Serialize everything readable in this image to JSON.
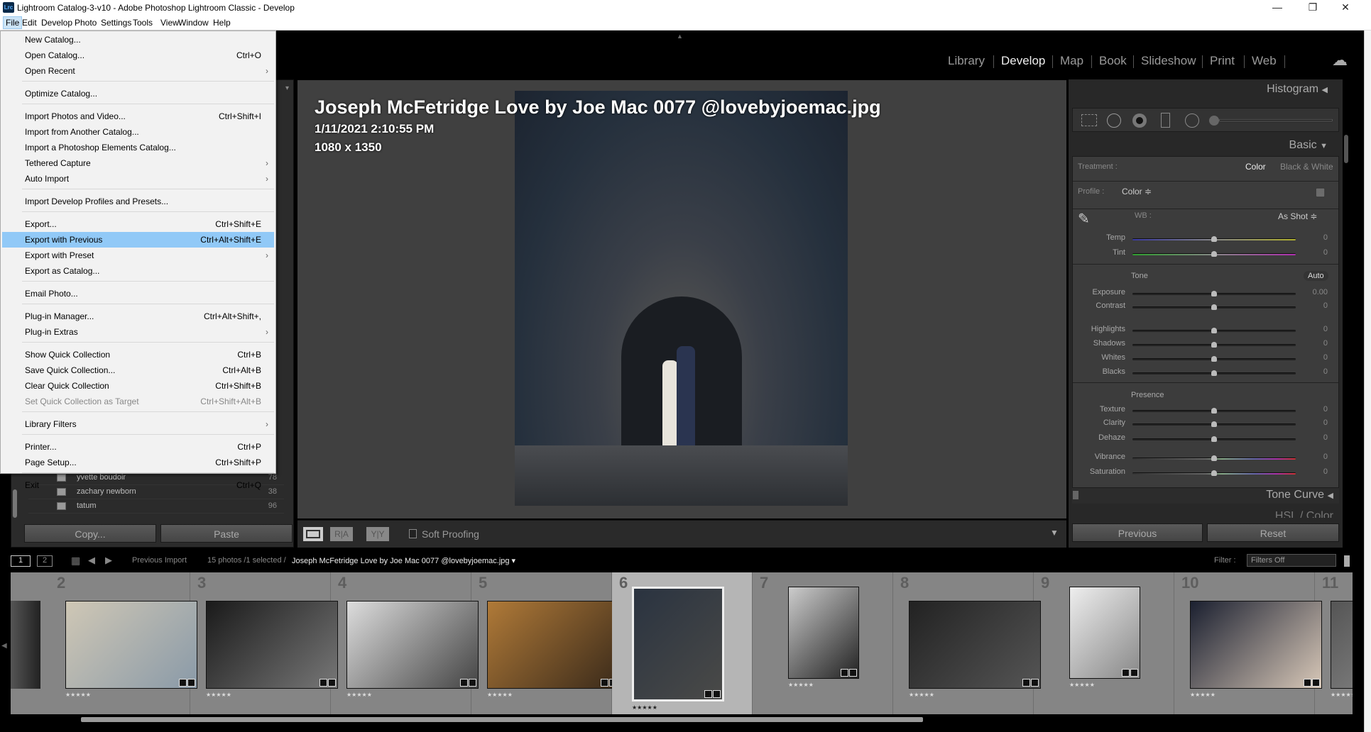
{
  "window": {
    "title": "Lightroom Catalog-3-v10 - Adobe Photoshop Lightroom Classic - Develop",
    "logo": "Lrc",
    "minimize": "—",
    "maximize": "❐",
    "close": "✕"
  },
  "menubar": [
    "File",
    "Edit",
    "Develop",
    "Photo",
    "Settings",
    "Tools",
    "View",
    "Window",
    "Help"
  ],
  "file_menu": [
    {
      "label": "New Catalog..."
    },
    {
      "label": "Open Catalog...",
      "shortcut": "Ctrl+O"
    },
    {
      "label": "Open Recent",
      "submenu": true
    },
    {
      "sep": true
    },
    {
      "label": "Optimize Catalog..."
    },
    {
      "sep": true
    },
    {
      "label": "Import Photos and Video...",
      "shortcut": "Ctrl+Shift+I"
    },
    {
      "label": "Import from Another Catalog..."
    },
    {
      "label": "Import a Photoshop Elements Catalog..."
    },
    {
      "label": "Tethered Capture",
      "submenu": true
    },
    {
      "label": "Auto Import",
      "submenu": true
    },
    {
      "sep": true
    },
    {
      "label": "Import Develop Profiles and Presets..."
    },
    {
      "sep": true
    },
    {
      "label": "Export...",
      "shortcut": "Ctrl+Shift+E"
    },
    {
      "label": "Export with Previous",
      "shortcut": "Ctrl+Alt+Shift+E",
      "highlighted": true
    },
    {
      "label": "Export with Preset",
      "submenu": true
    },
    {
      "label": "Export as Catalog..."
    },
    {
      "sep": true
    },
    {
      "label": "Email Photo..."
    },
    {
      "sep": true
    },
    {
      "label": "Plug-in Manager...",
      "shortcut": "Ctrl+Alt+Shift+,"
    },
    {
      "label": "Plug-in Extras",
      "submenu": true
    },
    {
      "sep": true
    },
    {
      "label": "Show Quick Collection",
      "shortcut": "Ctrl+B"
    },
    {
      "label": "Save Quick Collection...",
      "shortcut": "Ctrl+Alt+B"
    },
    {
      "label": "Clear Quick Collection",
      "shortcut": "Ctrl+Shift+B"
    },
    {
      "label": "Set Quick Collection as Target",
      "shortcut": "Ctrl+Shift+Alt+B",
      "disabled": true
    },
    {
      "sep": true
    },
    {
      "label": "Library Filters",
      "submenu": true
    },
    {
      "sep": true
    },
    {
      "label": "Printer...",
      "shortcut": "Ctrl+P"
    },
    {
      "label": "Page Setup...",
      "shortcut": "Ctrl+Shift+P"
    },
    {
      "sep": true
    },
    {
      "label": "Exit",
      "shortcut": "Ctrl+Q"
    }
  ],
  "modules": {
    "items": [
      "Library",
      "Develop",
      "Map",
      "Book",
      "Slideshow",
      "Print",
      "Web"
    ],
    "active": "Develop",
    "cloud_icon": "cloud-icon"
  },
  "left_panel": {
    "folders": [
      {
        "name": "yvette boudoir",
        "count": "78"
      },
      {
        "name": "zachary newborn",
        "count": "38"
      },
      {
        "name": "tatum",
        "count": "96"
      }
    ],
    "copy": "Copy...",
    "paste": "Paste"
  },
  "photo_info": {
    "filename": "Joseph McFetridge Love by Joe Mac 0077 @lovebyjoemac.jpg",
    "date": "1/11/2021 2:10:55 PM",
    "dimensions": "1080 x 1350"
  },
  "toolbar": {
    "soft_proofing": "Soft Proofing",
    "ra": "R|A",
    "yy": "Y|Y"
  },
  "right_panel": {
    "histogram": "Histogram",
    "basic": "Basic",
    "treatment_label": "Treatment :",
    "treatment_color": "Color",
    "treatment_bw": "Black & White",
    "profile_label": "Profile :",
    "profile_value": "Color ≑",
    "wb_label": "WB :",
    "wb_value": "As Shot ≑",
    "tone": "Tone",
    "auto": "Auto",
    "presence": "Presence",
    "sliders": [
      {
        "label": "Temp",
        "value": "0",
        "position": 0.5,
        "style": "temp"
      },
      {
        "label": "Tint",
        "value": "0",
        "position": 0.5,
        "style": "tint"
      },
      {
        "label": "Exposure",
        "value": "0.00",
        "position": 0.5
      },
      {
        "label": "Contrast",
        "value": "0",
        "position": 0.5
      },
      {
        "label": "Highlights",
        "value": "0",
        "position": 0.5
      },
      {
        "label": "Shadows",
        "value": "0",
        "position": 0.5
      },
      {
        "label": "Whites",
        "value": "0",
        "position": 0.5
      },
      {
        "label": "Blacks",
        "value": "0",
        "position": 0.5
      },
      {
        "label": "Texture",
        "value": "0",
        "position": 0.5
      },
      {
        "label": "Clarity",
        "value": "0",
        "position": 0.5
      },
      {
        "label": "Dehaze",
        "value": "0",
        "position": 0.5
      },
      {
        "label": "Vibrance",
        "value": "0",
        "position": 0.5,
        "style": "color"
      },
      {
        "label": "Saturation",
        "value": "0",
        "position": 0.5,
        "style": "color"
      }
    ],
    "tone_curve": "Tone Curve",
    "hsl": "HSL / Color",
    "previous": "Previous",
    "reset": "Reset"
  },
  "filmstrip_bar": {
    "view1": "1",
    "view2": "2",
    "source": "Previous Import",
    "count": "15 photos /1 selected /",
    "filename": "Joseph McFetridge Love by Joe Mac 0077 @lovebyjoemac.jpg ▾",
    "filter_label": "Filter :",
    "filter_value": "Filters Off"
  },
  "filmstrip": {
    "cells": [
      {
        "num": "2",
        "colors": [
          "#cfc7b5",
          "#8a9aa8"
        ]
      },
      {
        "num": "3",
        "colors": [
          "#1a1a1a",
          "#777"
        ]
      },
      {
        "num": "4",
        "colors": [
          "#ddd",
          "#444"
        ]
      },
      {
        "num": "5",
        "colors": [
          "#b07a38",
          "#3a2a1a"
        ]
      },
      {
        "num": "6",
        "colors": [
          "#2a3340",
          "#4a4a48"
        ],
        "selected": true
      },
      {
        "num": "7",
        "colors": [
          "#ccc",
          "#222"
        ]
      },
      {
        "num": "8",
        "colors": [
          "#222",
          "#555"
        ]
      },
      {
        "num": "9",
        "colors": [
          "#eee",
          "#888"
        ]
      },
      {
        "num": "10",
        "colors": [
          "#1b2030",
          "#d8c8b8"
        ]
      },
      {
        "num": "11",
        "colors": [
          "#555",
          "#999"
        ]
      }
    ],
    "stars": "★★★★★"
  }
}
